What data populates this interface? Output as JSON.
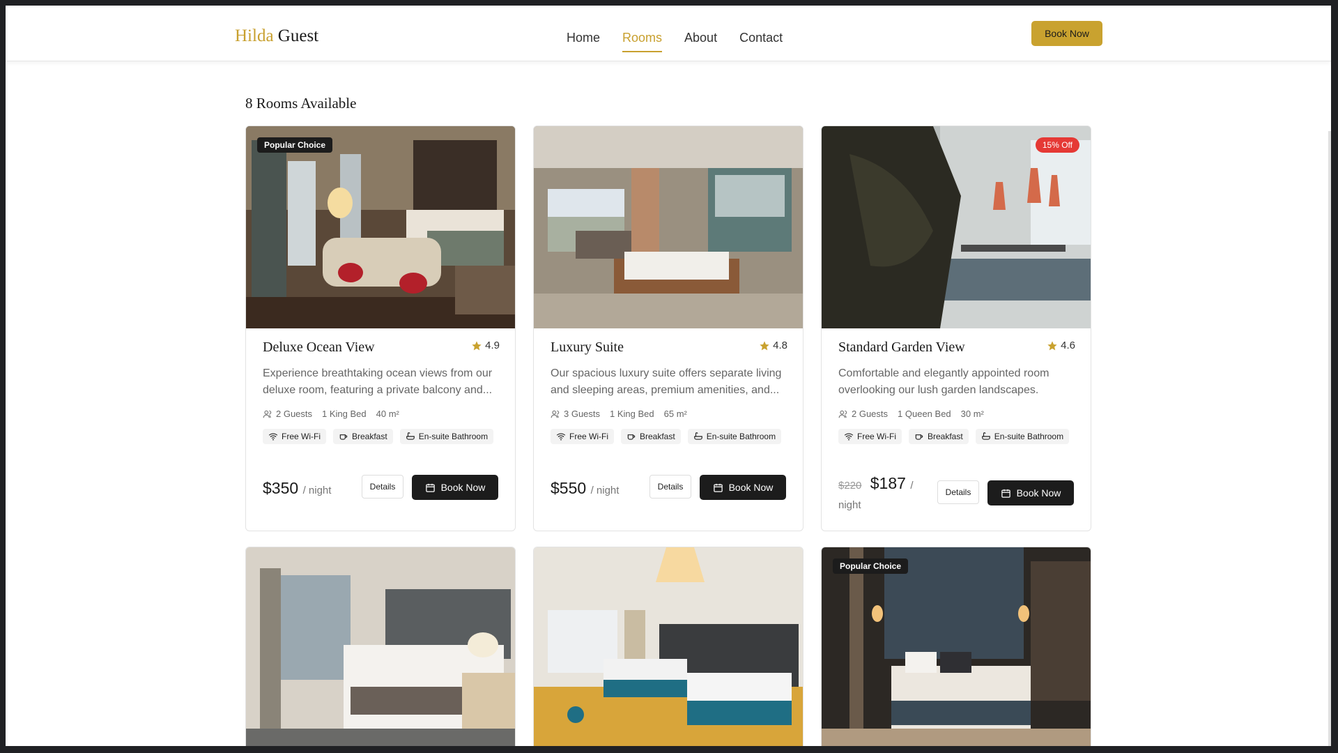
{
  "header": {
    "logo_accent": "Hilda",
    "logo_rest": " Guest",
    "nav": [
      "Home",
      "Rooms",
      "About",
      "Contact"
    ],
    "active_nav": "Rooms",
    "book_label": "Book Now"
  },
  "rooms_count": "8 Rooms Available",
  "rooms": [
    {
      "badge": "Popular Choice",
      "title": "Deluxe Ocean View",
      "rating": "4.9",
      "description": "Experience breathtaking ocean views from our deluxe room, featuring a private balcony and...",
      "guests": "2 Guests",
      "bed": "1 King Bed",
      "size": "40 m²",
      "amenities": [
        "Free Wi-Fi",
        "Breakfast",
        "En-suite Bathroom"
      ],
      "price": "$350",
      "per": "/ night",
      "details": "Details",
      "book": "Book Now"
    },
    {
      "title": "Luxury Suite",
      "rating": "4.8",
      "description": "Our spacious luxury suite offers separate living and sleeping areas, premium amenities, and...",
      "guests": "3 Guests",
      "bed": "1 King Bed",
      "size": "65 m²",
      "amenities": [
        "Free Wi-Fi",
        "Breakfast",
        "En-suite Bathroom"
      ],
      "price": "$550",
      "per": "/ night",
      "details": "Details",
      "book": "Book Now"
    },
    {
      "badge": "15% Off",
      "title": "Standard Garden View",
      "rating": "4.6",
      "description": "Comfortable and elegantly appointed room overlooking our lush garden landscapes.",
      "guests": "2 Guests",
      "bed": "1 Queen Bed",
      "size": "30 m²",
      "amenities": [
        "Free Wi-Fi",
        "Breakfast",
        "En-suite Bathroom"
      ],
      "old_price": "$220",
      "price": "$187",
      "per": "/ night",
      "details": "Details",
      "book": "Book Now"
    },
    {},
    {},
    {
      "badge": "Popular Choice"
    }
  ],
  "colors": {
    "accent": "#c9a22f",
    "dark": "#1c1c1c",
    "discount": "#e53935"
  }
}
